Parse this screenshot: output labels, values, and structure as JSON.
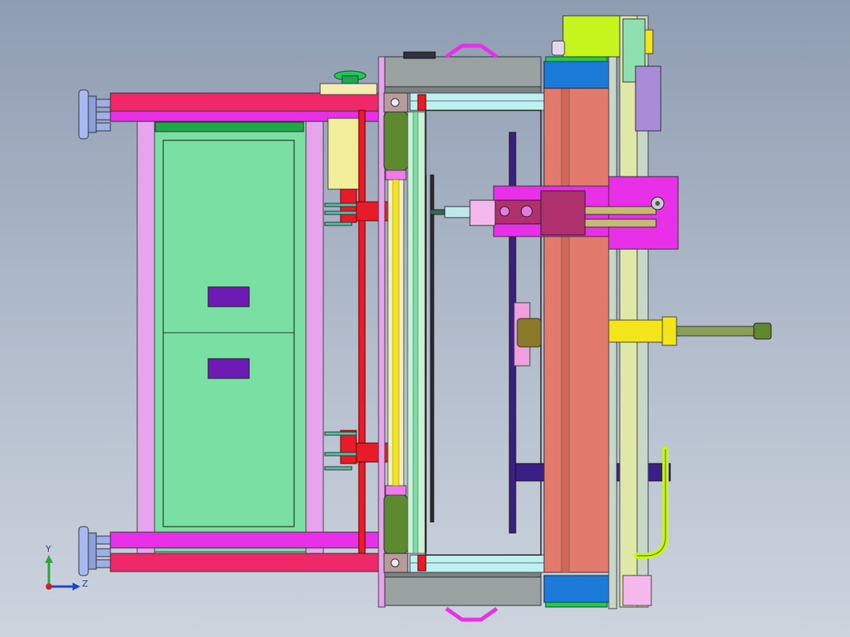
{
  "view": {
    "background_top": "#8f9db2",
    "background_bottom": "#cdd4de",
    "triad": {
      "y_label": "Y",
      "z_label": "Z"
    }
  },
  "colors": {
    "frame_rail": "#f0286a",
    "frame_magenta": "#e830e8",
    "post_lavender": "#e6a4ec",
    "panel_green": "#7adfa2",
    "panel_dark_green": "#1ea84a",
    "tab_purple": "#6d1bb4",
    "red_cylinder": "#e81c28",
    "roller_olive": "#5d8a2e",
    "salmon_plate": "#e27a6e",
    "blue_block": "#1c7bd8",
    "yellow_cylinder": "#f4e41a",
    "lime": "#c6f51e",
    "navy_disc": "#3a1f86",
    "gray_block": "#9aa1a1"
  }
}
